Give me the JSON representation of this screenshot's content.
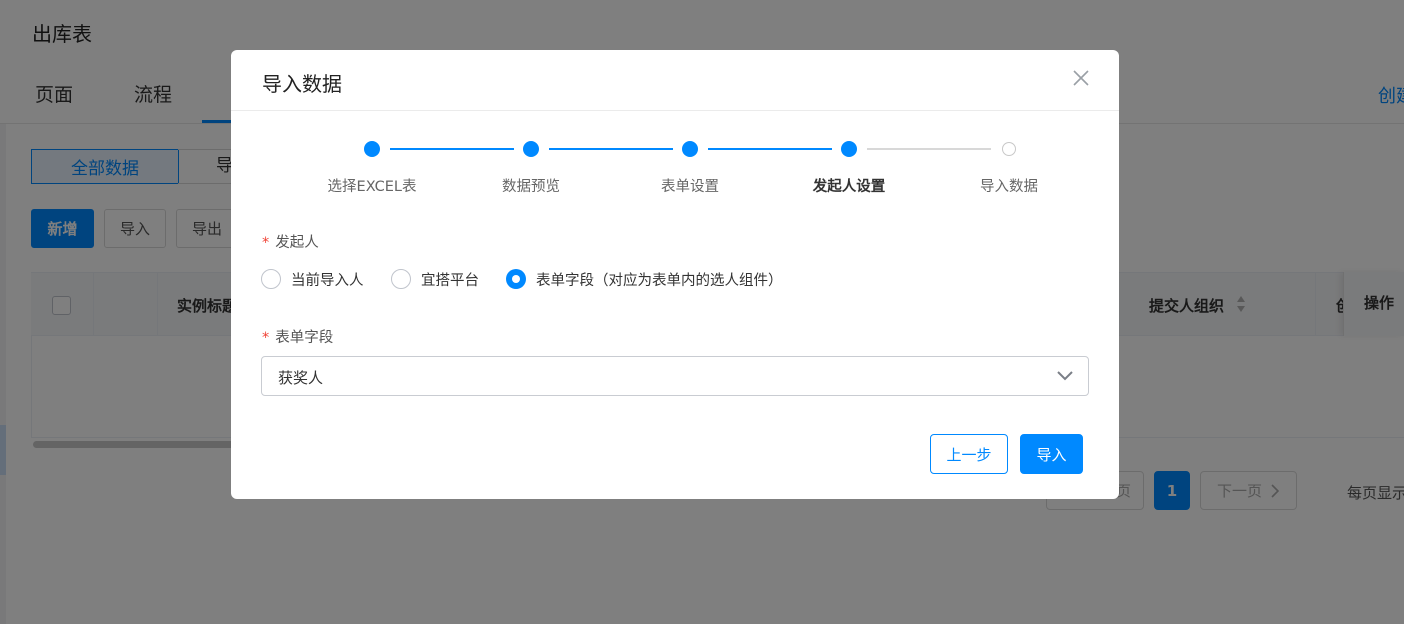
{
  "background": {
    "page_title": "出库表",
    "tabs": [
      "页面",
      "流程"
    ],
    "tab_right_label": "创建",
    "filter_active": "全部数据",
    "filter_next": "导",
    "toolbar": {
      "add": "新增",
      "import": "导入",
      "export": "导出"
    },
    "table": {
      "col_title": "实例标题",
      "col_org": "提交人组织",
      "col_cut": "创",
      "col_action": "操作"
    },
    "pagination": {
      "prev": "上一页",
      "current": "1",
      "next": "下一页",
      "info": "每页显示"
    }
  },
  "dialog": {
    "title": "导入数据",
    "steps": [
      {
        "label": "选择EXCEL表",
        "status": "done"
      },
      {
        "label": "数据预览",
        "status": "done"
      },
      {
        "label": "表单设置",
        "status": "done"
      },
      {
        "label": "发起人设置",
        "status": "active"
      },
      {
        "label": "导入数据",
        "status": "todo"
      }
    ],
    "initiator": {
      "label": "发起人",
      "options": [
        "当前导入人",
        "宜搭平台",
        "表单字段（对应为表单内的选人组件）"
      ],
      "selected_index": 2
    },
    "form_field": {
      "label": "表单字段",
      "value": "获奖人"
    },
    "buttons": {
      "prev": "上一步",
      "import": "导入"
    }
  },
  "colors": {
    "primary": "#0089ff",
    "required": "#f04134",
    "mask": "rgba(0,0,0,0.5)"
  }
}
